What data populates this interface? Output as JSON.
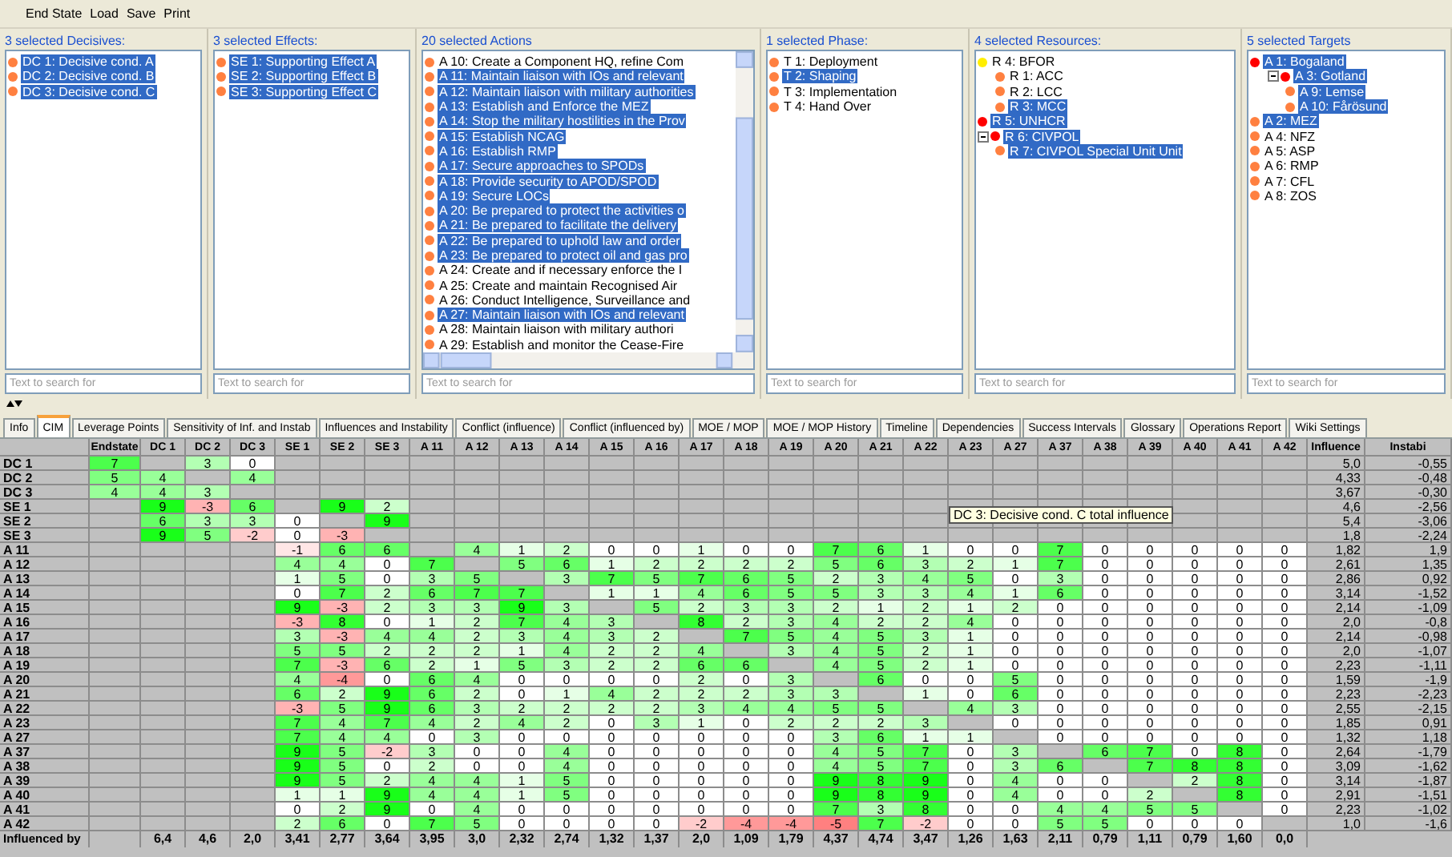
{
  "menu": [
    "End State",
    "Load",
    "Save",
    "Print"
  ],
  "panels": [
    {
      "kind": "plain",
      "title": "3 selected Decisives:",
      "search": {
        "placeholder": "Text to search for"
      },
      "items": [
        {
          "label": "DC 1: Decisive cond. A",
          "selected": true,
          "color": "#ff8040"
        },
        {
          "label": "DC 2: Decisive cond. B",
          "selected": true,
          "color": "#ff8040"
        },
        {
          "label": "DC 3: Decisive cond. C",
          "selected": true,
          "color": "#ff8040"
        }
      ]
    },
    {
      "kind": "plain",
      "title": "3 selected Effects:",
      "search": {
        "placeholder": "Text to search for"
      },
      "items": [
        {
          "label": "SE 1: Supporting Effect A",
          "selected": true,
          "color": "#ff8040"
        },
        {
          "label": "SE 2: Supporting Effect B",
          "selected": true,
          "color": "#ff8040"
        },
        {
          "label": "SE 3: Supporting Effect C",
          "selected": true,
          "color": "#ff8040"
        }
      ]
    },
    {
      "kind": "scroll",
      "title": "20 selected Actions",
      "search": {
        "placeholder": "Text to search for"
      },
      "items": [
        {
          "label": "A 10: Create a Component HQ, refine Com",
          "selected": false,
          "color": "#ff8040"
        },
        {
          "label": "A 11: Maintain liaison with IOs and relevant",
          "selected": true,
          "color": "#ff8040"
        },
        {
          "label": "A 12: Maintain liaison with military authorities",
          "selected": true,
          "color": "#ff8040"
        },
        {
          "label": "A 13: Establish and Enforce the MEZ",
          "selected": true,
          "color": "#ff8040"
        },
        {
          "label": "A 14: Stop the military hostilities in the Prov",
          "selected": true,
          "color": "#ff8040"
        },
        {
          "label": "A 15: Establish NCAG",
          "selected": true,
          "color": "#ff8040"
        },
        {
          "label": "A 16: Establish RMP",
          "selected": true,
          "color": "#ff8040"
        },
        {
          "label": "A 17: Secure approaches to SPODs",
          "selected": true,
          "color": "#ff8040"
        },
        {
          "label": "A 18: Provide security to APOD/SPOD",
          "selected": true,
          "color": "#ff8040"
        },
        {
          "label": "A 19: Secure LOCs",
          "selected": true,
          "color": "#ff8040"
        },
        {
          "label": "A 20: Be prepared to protect the activities o",
          "selected": true,
          "color": "#ff8040"
        },
        {
          "label": "A 21: Be prepared to facilitate the delivery",
          "selected": true,
          "color": "#ff8040"
        },
        {
          "label": "A 22: Be prepared to uphold law and order",
          "selected": true,
          "color": "#ff8040"
        },
        {
          "label": "A 23: Be prepared to protect oil and gas pro",
          "selected": true,
          "color": "#ff8040"
        },
        {
          "label": "A 24: Create and if necessary enforce the I",
          "selected": false,
          "color": "#ff8040"
        },
        {
          "label": "A 25: Create and maintain Recognised Air",
          "selected": false,
          "color": "#ff8040"
        },
        {
          "label": "A 26: Conduct Intelligence, Surveillance and",
          "selected": false,
          "color": "#ff8040"
        },
        {
          "label": "A 27: Maintain liaison with IOs and relevant",
          "selected": true,
          "color": "#ff8040"
        },
        {
          "label": "A 28: Maintain liaison with military authori",
          "selected": false,
          "color": "#ff8040"
        },
        {
          "label": "A 29: Establish and monitor the Cease-Fire",
          "selected": false,
          "color": "#ff8040"
        }
      ]
    },
    {
      "kind": "plain",
      "title": "1 selected Phase:",
      "search": {
        "placeholder": "Text to search for"
      },
      "items": [
        {
          "label": "T 1: Deployment",
          "selected": false,
          "color": "#ff8040"
        },
        {
          "label": "T 2: Shaping",
          "selected": true,
          "color": "#ff8040"
        },
        {
          "label": "T 3: Implementation",
          "selected": false,
          "color": "#ff8040"
        },
        {
          "label": "T 4: Hand Over",
          "selected": false,
          "color": "#ff8040"
        }
      ]
    },
    {
      "kind": "plain",
      "title": "4 selected Resources:",
      "search": {
        "placeholder": "Text to search for"
      },
      "items": [
        {
          "label": "R 4: BFOR",
          "selected": false,
          "color": "#ffee00",
          "children": [
            {
              "label": "R 1: ACC",
              "selected": false,
              "color": "#ff8040"
            },
            {
              "label": "R 2: LCC",
              "selected": false,
              "color": "#ff8040"
            },
            {
              "label": "R 3: MCC",
              "selected": true,
              "color": "#ff8040"
            }
          ]
        },
        {
          "label": "R 5: UNHCR",
          "selected": true,
          "color": "#ff0000"
        },
        {
          "label": "R 6: CIVPOL",
          "selected": true,
          "color": "#ff0000",
          "expanded": true,
          "children": [
            {
              "label": "R 7: CIVPOL Special Unit Unit",
              "selected": true,
              "color": "#ff8040"
            }
          ]
        }
      ]
    },
    {
      "kind": "plain",
      "title": "5 selected Targets",
      "search": {
        "placeholder": "Text to search for"
      },
      "items": [
        {
          "label": "A 1: Bogaland",
          "selected": true,
          "color": "#ff0000",
          "children": [
            {
              "label": "A 3: Gotland",
              "selected": true,
              "color": "#ff0000",
              "expanded": true,
              "children": [
                {
                  "label": "A 9: Lemse",
                  "selected": true,
                  "color": "#ff8040"
                },
                {
                  "label": "A 10: Fårösund",
                  "selected": true,
                  "color": "#ff8040"
                }
              ]
            }
          ]
        },
        {
          "label": "A 2: MEZ",
          "selected": true,
          "color": "#ff8040"
        },
        {
          "label": "A 4: NFZ",
          "selected": false,
          "color": "#ff8040"
        },
        {
          "label": "A 5: ASP",
          "selected": false,
          "color": "#ff8040"
        },
        {
          "label": "A 6: RMP",
          "selected": false,
          "color": "#ff8040"
        },
        {
          "label": "A 7: CFL",
          "selected": false,
          "color": "#ff8040"
        },
        {
          "label": "A 8: ZOS",
          "selected": false,
          "color": "#ff8040"
        }
      ]
    }
  ],
  "tabs": [
    {
      "label": "Info",
      "selected": false
    },
    {
      "label": "CIM",
      "selected": true
    },
    {
      "label": "Leverage Points",
      "selected": false
    },
    {
      "label": "Sensitivity of Inf. and Instab",
      "selected": false
    },
    {
      "label": "Influences and Instability",
      "selected": false
    },
    {
      "label": "Conflict (influence)",
      "selected": false
    },
    {
      "label": "Conflict (influenced by)",
      "selected": false
    },
    {
      "label": "MOE / MOP",
      "selected": false
    },
    {
      "label": "MOE / MOP History",
      "selected": false
    },
    {
      "label": "Timeline",
      "selected": false
    },
    {
      "label": "Dependencies",
      "selected": false
    },
    {
      "label": "Success Intervals",
      "selected": false
    },
    {
      "label": "Glossary",
      "selected": false
    },
    {
      "label": "Operations Report",
      "selected": false
    },
    {
      "label": "Wiki Settings",
      "selected": false
    }
  ],
  "matrix": {
    "columns": [
      "Endstate",
      "DC 1",
      "DC 2",
      "DC 3",
      "SE 1",
      "SE 2",
      "SE 3",
      "A 11",
      "A 12",
      "A 13",
      "A 14",
      "A 15",
      "A 16",
      "A 17",
      "A 18",
      "A 19",
      "A 20",
      "A 21",
      "A 22",
      "A 23",
      "A 27",
      "A 37",
      "A 38",
      "A 39",
      "A 40",
      "A 41",
      "A 42",
      "Influence",
      "Instabi"
    ],
    "rows": [
      {
        "label": "DC 1",
        "influence": "5,0",
        "instability": "-0,55",
        "cells": [
          "7",
          null,
          "3",
          "0",
          null,
          null,
          null,
          null,
          null,
          null,
          null,
          null,
          null,
          null,
          null,
          null,
          null,
          null,
          null,
          null,
          null,
          null,
          null,
          null,
          null,
          null,
          null
        ]
      },
      {
        "label": "DC 2",
        "influence": "4,33",
        "instability": "-0,48",
        "cells": [
          "5",
          "4",
          null,
          "4",
          null,
          null,
          null,
          null,
          null,
          null,
          null,
          null,
          null,
          null,
          null,
          null,
          null,
          null,
          null,
          null,
          null,
          null,
          null,
          null,
          null,
          null,
          null
        ]
      },
      {
        "label": "DC 3",
        "influence": "3,67",
        "instability": "-0,30",
        "cells": [
          "4",
          "4",
          "3",
          null,
          null,
          null,
          null,
          null,
          null,
          null,
          null,
          null,
          null,
          null,
          null,
          null,
          null,
          null,
          null,
          null,
          null,
          null,
          null,
          null,
          null,
          null,
          null
        ]
      },
      {
        "label": "SE 1",
        "influence": "4,6",
        "instability": "-2,56",
        "cells": [
          null,
          "9",
          "-3",
          "6",
          null,
          "9",
          "2",
          null,
          null,
          null,
          null,
          null,
          null,
          null,
          null,
          null,
          null,
          null,
          null,
          null,
          null,
          null,
          null,
          null,
          null,
          null,
          null
        ]
      },
      {
        "label": "SE 2",
        "influence": "5,4",
        "instability": "-3,06",
        "cells": [
          null,
          "6",
          "3",
          "3",
          "0",
          null,
          "9",
          null,
          null,
          null,
          null,
          null,
          null,
          null,
          null,
          null,
          null,
          null,
          null,
          null,
          null,
          null,
          null,
          null,
          null,
          null,
          null
        ]
      },
      {
        "label": "SE 3",
        "influence": "1,8",
        "instability": "-2,24",
        "cells": [
          null,
          "9",
          "5",
          "-2",
          "0",
          "-3",
          null,
          null,
          null,
          null,
          null,
          null,
          null,
          null,
          null,
          null,
          null,
          null,
          null,
          null,
          null,
          null,
          null,
          null,
          null,
          null,
          null
        ]
      },
      {
        "label": "A 11",
        "influence": "1,82",
        "instability": "1,9",
        "cells": [
          null,
          null,
          null,
          null,
          "-1",
          "6",
          "6",
          null,
          "4",
          "1",
          "2",
          "0",
          "0",
          "1",
          "0",
          "0",
          "7",
          "6",
          "1",
          "0",
          "0",
          "7",
          "0",
          "0",
          "0",
          "0",
          "0"
        ]
      },
      {
        "label": "A 12",
        "influence": "2,61",
        "instability": "1,35",
        "cells": [
          null,
          null,
          null,
          null,
          "4",
          "4",
          "0",
          "7",
          null,
          "5",
          "6",
          "1",
          "2",
          "2",
          "2",
          "2",
          "5",
          "6",
          "3",
          "2",
          "1",
          "7",
          "0",
          "0",
          "0",
          "0",
          "0"
        ]
      },
      {
        "label": "A 13",
        "influence": "2,86",
        "instability": "0,92",
        "cells": [
          null,
          null,
          null,
          null,
          "1",
          "5",
          "0",
          "3",
          "5",
          null,
          "3",
          "7",
          "5",
          "7",
          "6",
          "5",
          "2",
          "3",
          "4",
          "5",
          "0",
          "3",
          "0",
          "0",
          "0",
          "0",
          "0"
        ]
      },
      {
        "label": "A 14",
        "influence": "3,14",
        "instability": "-1,52",
        "cells": [
          null,
          null,
          null,
          null,
          "0",
          "7",
          "2",
          "6",
          "7",
          "7",
          null,
          "1",
          "1",
          "4",
          "6",
          "5",
          "5",
          "3",
          "3",
          "4",
          "1",
          "6",
          "0",
          "0",
          "0",
          "0",
          "0"
        ]
      },
      {
        "label": "A 15",
        "influence": "2,14",
        "instability": "-1,09",
        "cells": [
          null,
          null,
          null,
          null,
          "9",
          "-3",
          "2",
          "3",
          "3",
          "9",
          "3",
          null,
          "5",
          "2",
          "3",
          "3",
          "2",
          "1",
          "2",
          "1",
          "2",
          "0",
          "0",
          "0",
          "0",
          "0",
          "0"
        ]
      },
      {
        "label": "A 16",
        "influence": "2,0",
        "instability": "-0,8",
        "cells": [
          null,
          null,
          null,
          null,
          "-3",
          "8",
          "0",
          "1",
          "2",
          "7",
          "4",
          "3",
          null,
          "8",
          "2",
          "3",
          "4",
          "2",
          "2",
          "4",
          "0",
          "0",
          "0",
          "0",
          "0",
          "0",
          "0"
        ]
      },
      {
        "label": "A 17",
        "influence": "2,14",
        "instability": "-0,98",
        "cells": [
          null,
          null,
          null,
          null,
          "3",
          "-3",
          "4",
          "4",
          "2",
          "3",
          "4",
          "3",
          "2",
          null,
          "7",
          "5",
          "4",
          "5",
          "3",
          "1",
          "0",
          "0",
          "0",
          "0",
          "0",
          "0",
          "0"
        ]
      },
      {
        "label": "A 18",
        "influence": "2,0",
        "instability": "-1,07",
        "cells": [
          null,
          null,
          null,
          null,
          "5",
          "5",
          "2",
          "2",
          "2",
          "1",
          "4",
          "2",
          "2",
          "4",
          null,
          "3",
          "4",
          "5",
          "2",
          "1",
          "0",
          "0",
          "0",
          "0",
          "0",
          "0",
          "0"
        ]
      },
      {
        "label": "A 19",
        "influence": "2,23",
        "instability": "-1,11",
        "cells": [
          null,
          null,
          null,
          null,
          "7",
          "-3",
          "6",
          "2",
          "1",
          "5",
          "3",
          "2",
          "2",
          "6",
          "6",
          null,
          "4",
          "5",
          "2",
          "1",
          "0",
          "0",
          "0",
          "0",
          "0",
          "0",
          "0"
        ]
      },
      {
        "label": "A 20",
        "influence": "1,59",
        "instability": "-1,9",
        "cells": [
          null,
          null,
          null,
          null,
          "4",
          "-4",
          "0",
          "6",
          "4",
          "0",
          "0",
          "0",
          "0",
          "2",
          "0",
          "3",
          null,
          "6",
          "0",
          "0",
          "5",
          "0",
          "0",
          "0",
          "0",
          "0",
          "0"
        ]
      },
      {
        "label": "A 21",
        "influence": "2,23",
        "instability": "-2,23",
        "cells": [
          null,
          null,
          null,
          null,
          "6",
          "2",
          "9",
          "6",
          "2",
          "0",
          "1",
          "4",
          "2",
          "2",
          "2",
          "3",
          "3",
          null,
          "1",
          "0",
          "6",
          "0",
          "0",
          "0",
          "0",
          "0",
          "0"
        ]
      },
      {
        "label": "A 22",
        "influence": "2,55",
        "instability": "-2,15",
        "cells": [
          null,
          null,
          null,
          null,
          "-3",
          "5",
          "9",
          "6",
          "3",
          "2",
          "2",
          "2",
          "2",
          "3",
          "4",
          "4",
          "5",
          "5",
          null,
          "4",
          "3",
          "0",
          "0",
          "0",
          "0",
          "0",
          "0"
        ]
      },
      {
        "label": "A 23",
        "influence": "1,85",
        "instability": "0,91",
        "cells": [
          null,
          null,
          null,
          null,
          "7",
          "4",
          "7",
          "4",
          "2",
          "4",
          "2",
          "0",
          "3",
          "1",
          "0",
          "2",
          "2",
          "2",
          "3",
          null,
          "0",
          "0",
          "0",
          "0",
          "0",
          "0",
          "0"
        ]
      },
      {
        "label": "A 27",
        "influence": "1,32",
        "instability": "1,18",
        "cells": [
          null,
          null,
          null,
          null,
          "7",
          "4",
          "4",
          "0",
          "3",
          "0",
          "0",
          "0",
          "0",
          "0",
          "0",
          "0",
          "3",
          "6",
          "1",
          "1",
          null,
          "0",
          "0",
          "0",
          "0",
          "0",
          "0"
        ]
      },
      {
        "label": "A 37",
        "influence": "2,64",
        "instability": "-1,79",
        "cells": [
          null,
          null,
          null,
          null,
          "9",
          "5",
          "-2",
          "3",
          "0",
          "0",
          "4",
          "0",
          "0",
          "0",
          "0",
          "0",
          "4",
          "5",
          "7",
          "0",
          "3",
          null,
          "6",
          "7",
          "0",
          "8",
          "0"
        ]
      },
      {
        "label": "A 38",
        "influence": "3,09",
        "instability": "-1,62",
        "cells": [
          null,
          null,
          null,
          null,
          "9",
          "5",
          "0",
          "2",
          "0",
          "0",
          "4",
          "0",
          "0",
          "0",
          "0",
          "0",
          "4",
          "5",
          "7",
          "0",
          "3",
          "6",
          null,
          "7",
          "8",
          "8",
          "0"
        ]
      },
      {
        "label": "A 39",
        "influence": "3,14",
        "instability": "-1,87",
        "cells": [
          null,
          null,
          null,
          null,
          "9",
          "5",
          "2",
          "4",
          "4",
          "1",
          "5",
          "0",
          "0",
          "0",
          "0",
          "0",
          "9",
          "8",
          "9",
          "0",
          "4",
          "0",
          "0",
          null,
          "2",
          "8",
          "0"
        ]
      },
      {
        "label": "A 40",
        "influence": "2,91",
        "instability": "-1,51",
        "cells": [
          null,
          null,
          null,
          null,
          "1",
          "1",
          "9",
          "4",
          "4",
          "1",
          "5",
          "0",
          "0",
          "0",
          "0",
          "0",
          "9",
          "8",
          "9",
          "0",
          "4",
          "0",
          "0",
          "2",
          null,
          "8",
          "0"
        ]
      },
      {
        "label": "A 41",
        "influence": "2,23",
        "instability": "-1,02",
        "cells": [
          null,
          null,
          null,
          null,
          "0",
          "2",
          "9",
          "0",
          "4",
          "0",
          "0",
          "0",
          "0",
          "0",
          "0",
          "0",
          "7",
          "3",
          "8",
          "0",
          "0",
          "4",
          "4",
          "5",
          "5",
          null,
          "0"
        ]
      },
      {
        "label": "A 42",
        "influence": "1,0",
        "instability": "-1,6",
        "cells": [
          null,
          null,
          null,
          null,
          "2",
          "6",
          "0",
          "7",
          "5",
          "0",
          "0",
          "0",
          "0",
          "-2",
          "-4",
          "-4",
          "-5",
          "7",
          "-2",
          "0",
          "0",
          "5",
          "5",
          "0",
          "0",
          "0",
          null
        ]
      }
    ],
    "footer": {
      "label": "Influenced by",
      "cells": [
        null,
        "6,4",
        "4,6",
        "2,0",
        "3,41",
        "2,77",
        "3,64",
        "3,95",
        "3,0",
        "2,32",
        "2,74",
        "1,32",
        "1,37",
        "2,0",
        "1,09",
        "1,79",
        "4,37",
        "4,74",
        "3,47",
        "1,26",
        "1,63",
        "2,11",
        "0,79",
        "1,11",
        "0,79",
        "1,60",
        "0,0"
      ]
    },
    "tooltip": "DC 3: Decisive cond. C total influence"
  }
}
